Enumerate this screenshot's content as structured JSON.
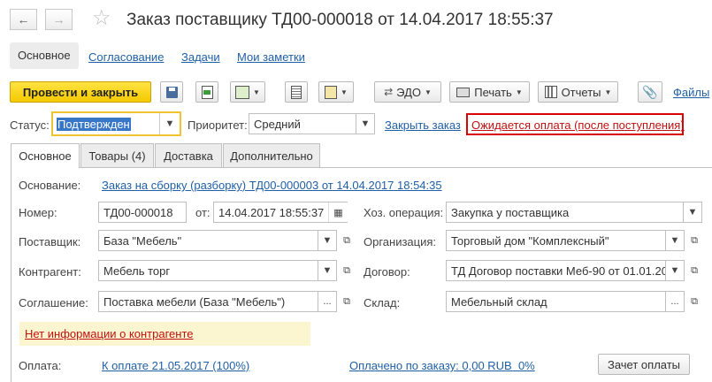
{
  "window": {
    "title": "Заказ поставщику ТД00-000018 от 14.04.2017 18:55:37"
  },
  "nav_tabs": [
    "Основное",
    "Согласование",
    "Задачи",
    "Мои заметки"
  ],
  "toolbar": {
    "post_close": "Провести и закрыть",
    "edo": "ЭДО",
    "print": "Печать",
    "reports": "Отчеты",
    "files": "Файлы"
  },
  "status_bar": {
    "status_label": "Статус:",
    "status_value": "Подтвержден",
    "priority_label": "Приоритет:",
    "priority_value": "Средний",
    "close_order": "Закрыть заказ",
    "awaiting": "Ожидается оплата (после поступления)"
  },
  "form_tabs": [
    "Основное",
    "Товары (4)",
    "Доставка",
    "Дополнительно"
  ],
  "form": {
    "basis_label": "Основание:",
    "basis_value": "Заказ на сборку (разборку) ТД00-000003 от 14.04.2017 18:54:35",
    "number_label": "Номер:",
    "number_value": "ТД00-000018",
    "date_label": "от:",
    "date_value": "14.04.2017 18:55:37",
    "operation_label": "Хоз. операция:",
    "operation_value": "Закупка у поставщика",
    "supplier_label": "Поставщик:",
    "supplier_value": "База \"Мебель\"",
    "org_label": "Организация:",
    "org_value": "Торговый дом \"Комплексный\"",
    "counterparty_label": "Контрагент:",
    "counterparty_value": "Мебель торг",
    "contract_label": "Договор:",
    "contract_value": "ТД Договор поставки Меб-90 от 01.01.20",
    "agreement_label": "Соглашение:",
    "agreement_value": "Поставка мебели (База \"Мебель\")",
    "warehouse_label": "Склад:",
    "warehouse_value": "Мебельный склад",
    "no_info": "Нет информации о контрагенте",
    "payment_label": "Оплата:",
    "payment_link": "К оплате 21.05.2017 (100%)",
    "paid_link": "Оплачено по заказу: 0,00 RUB  0%",
    "offset_button": "Зачет оплаты"
  }
}
